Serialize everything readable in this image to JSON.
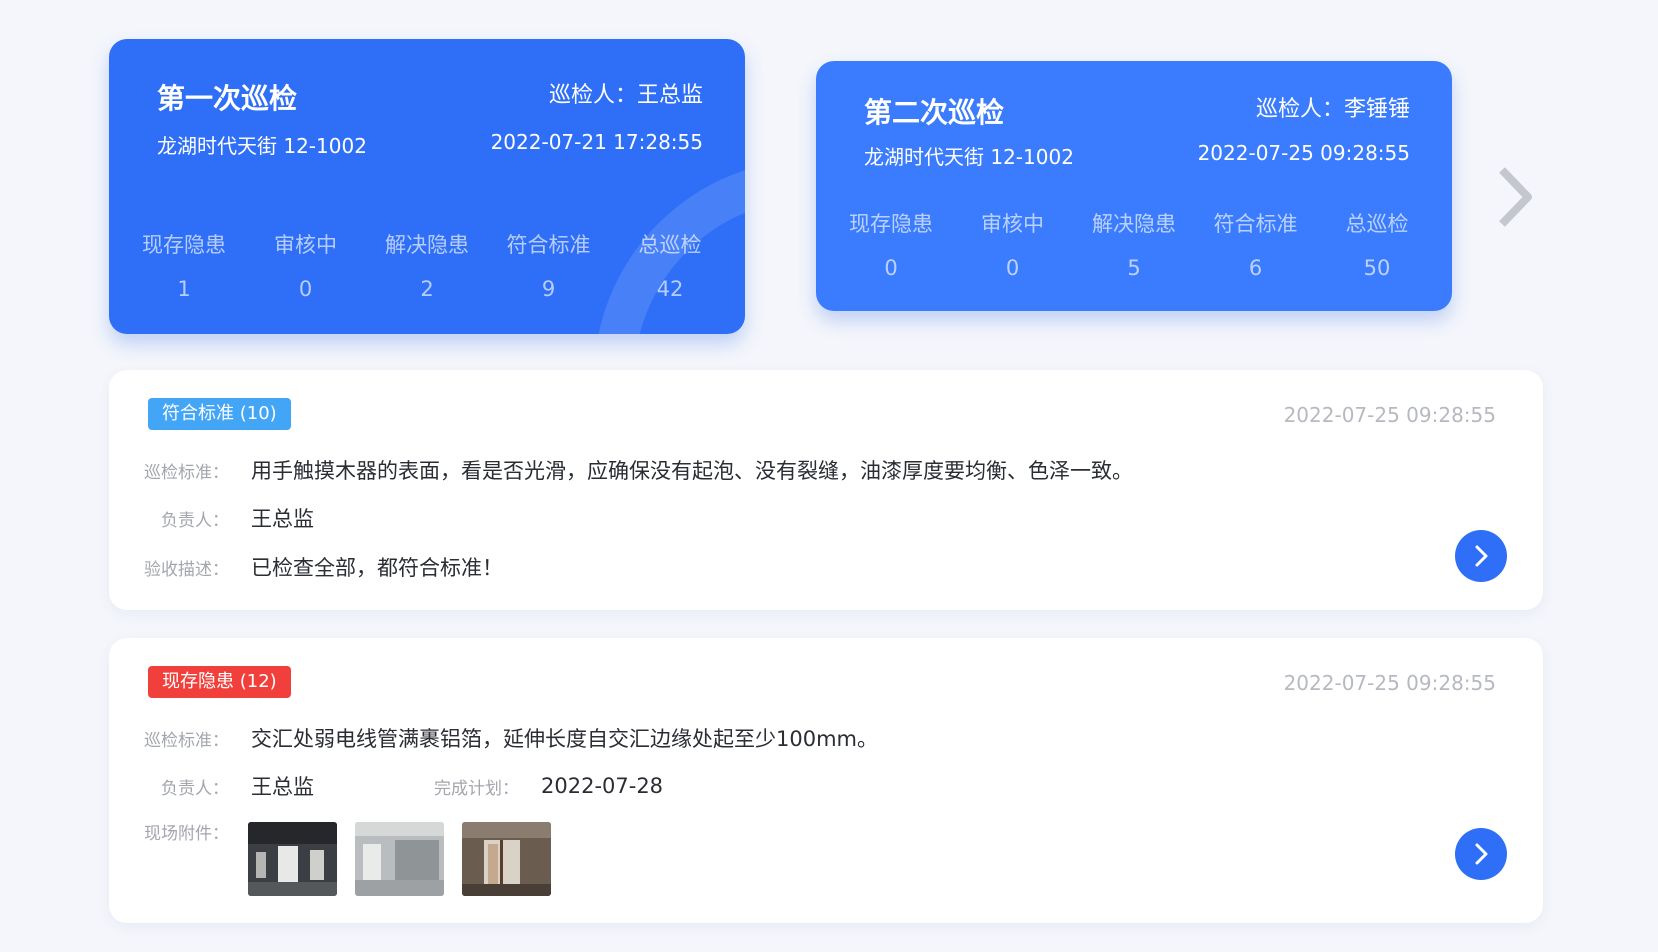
{
  "colors": {
    "card_blue": "#3a7cfd",
    "button_blue": "#2f6ff7",
    "badge_pass": "#42a5f5",
    "badge_risk": "#f1403c",
    "muted": "#a3a6ad"
  },
  "inspections": [
    {
      "title": "第一次巡检",
      "inspector": "巡检人：王总监",
      "address": "龙湖时代天街 12-1002",
      "time": "2022-07-21 17:28:55",
      "stats": [
        {
          "label": "现存隐患",
          "value": "1"
        },
        {
          "label": "审核中",
          "value": "0"
        },
        {
          "label": "解决隐患",
          "value": "2"
        },
        {
          "label": "符合标准",
          "value": "9"
        },
        {
          "label": "总巡检",
          "value": "42"
        }
      ]
    },
    {
      "title": "第二次巡检",
      "inspector": "巡检人：李锤锤",
      "address": "龙湖时代天街 12-1002",
      "time": "2022-07-25 09:28:55",
      "stats": [
        {
          "label": "现存隐患",
          "value": "0"
        },
        {
          "label": "审核中",
          "value": "0"
        },
        {
          "label": "解决隐患",
          "value": "5"
        },
        {
          "label": "符合标准",
          "value": "6"
        },
        {
          "label": "总巡检",
          "value": "50"
        }
      ]
    }
  ],
  "records": [
    {
      "badge": "符合标准 (10)",
      "time": "2022-07-25 09:28:55",
      "standard_label": "巡检标准：",
      "standard": "用手触摸木器的表面，看是否光滑，应确保没有起泡、没有裂缝，油漆厚度要均衡、色泽一致。",
      "owner_label": "负责人：",
      "owner": "王总监",
      "desc_label": "验收描述：",
      "desc": "已检查全部，都符合标准！"
    },
    {
      "badge": "现存隐患 (12)",
      "time": "2022-07-25 09:28:55",
      "standard_label": "巡检标准：",
      "standard": "交汇处弱电线管满裹铝箔，延伸长度自交汇边缘处起至少100mm。",
      "owner_label": "负责人：",
      "owner": "王总监",
      "plan_label": "完成计划：",
      "plan": "2022-07-28",
      "attach_label": "现场附件：",
      "attachments": [
        "site-photo-1",
        "site-photo-2",
        "site-photo-3"
      ]
    }
  ],
  "icons": {
    "next": "chevron-right-icon",
    "go": "chevron-right-icon"
  }
}
